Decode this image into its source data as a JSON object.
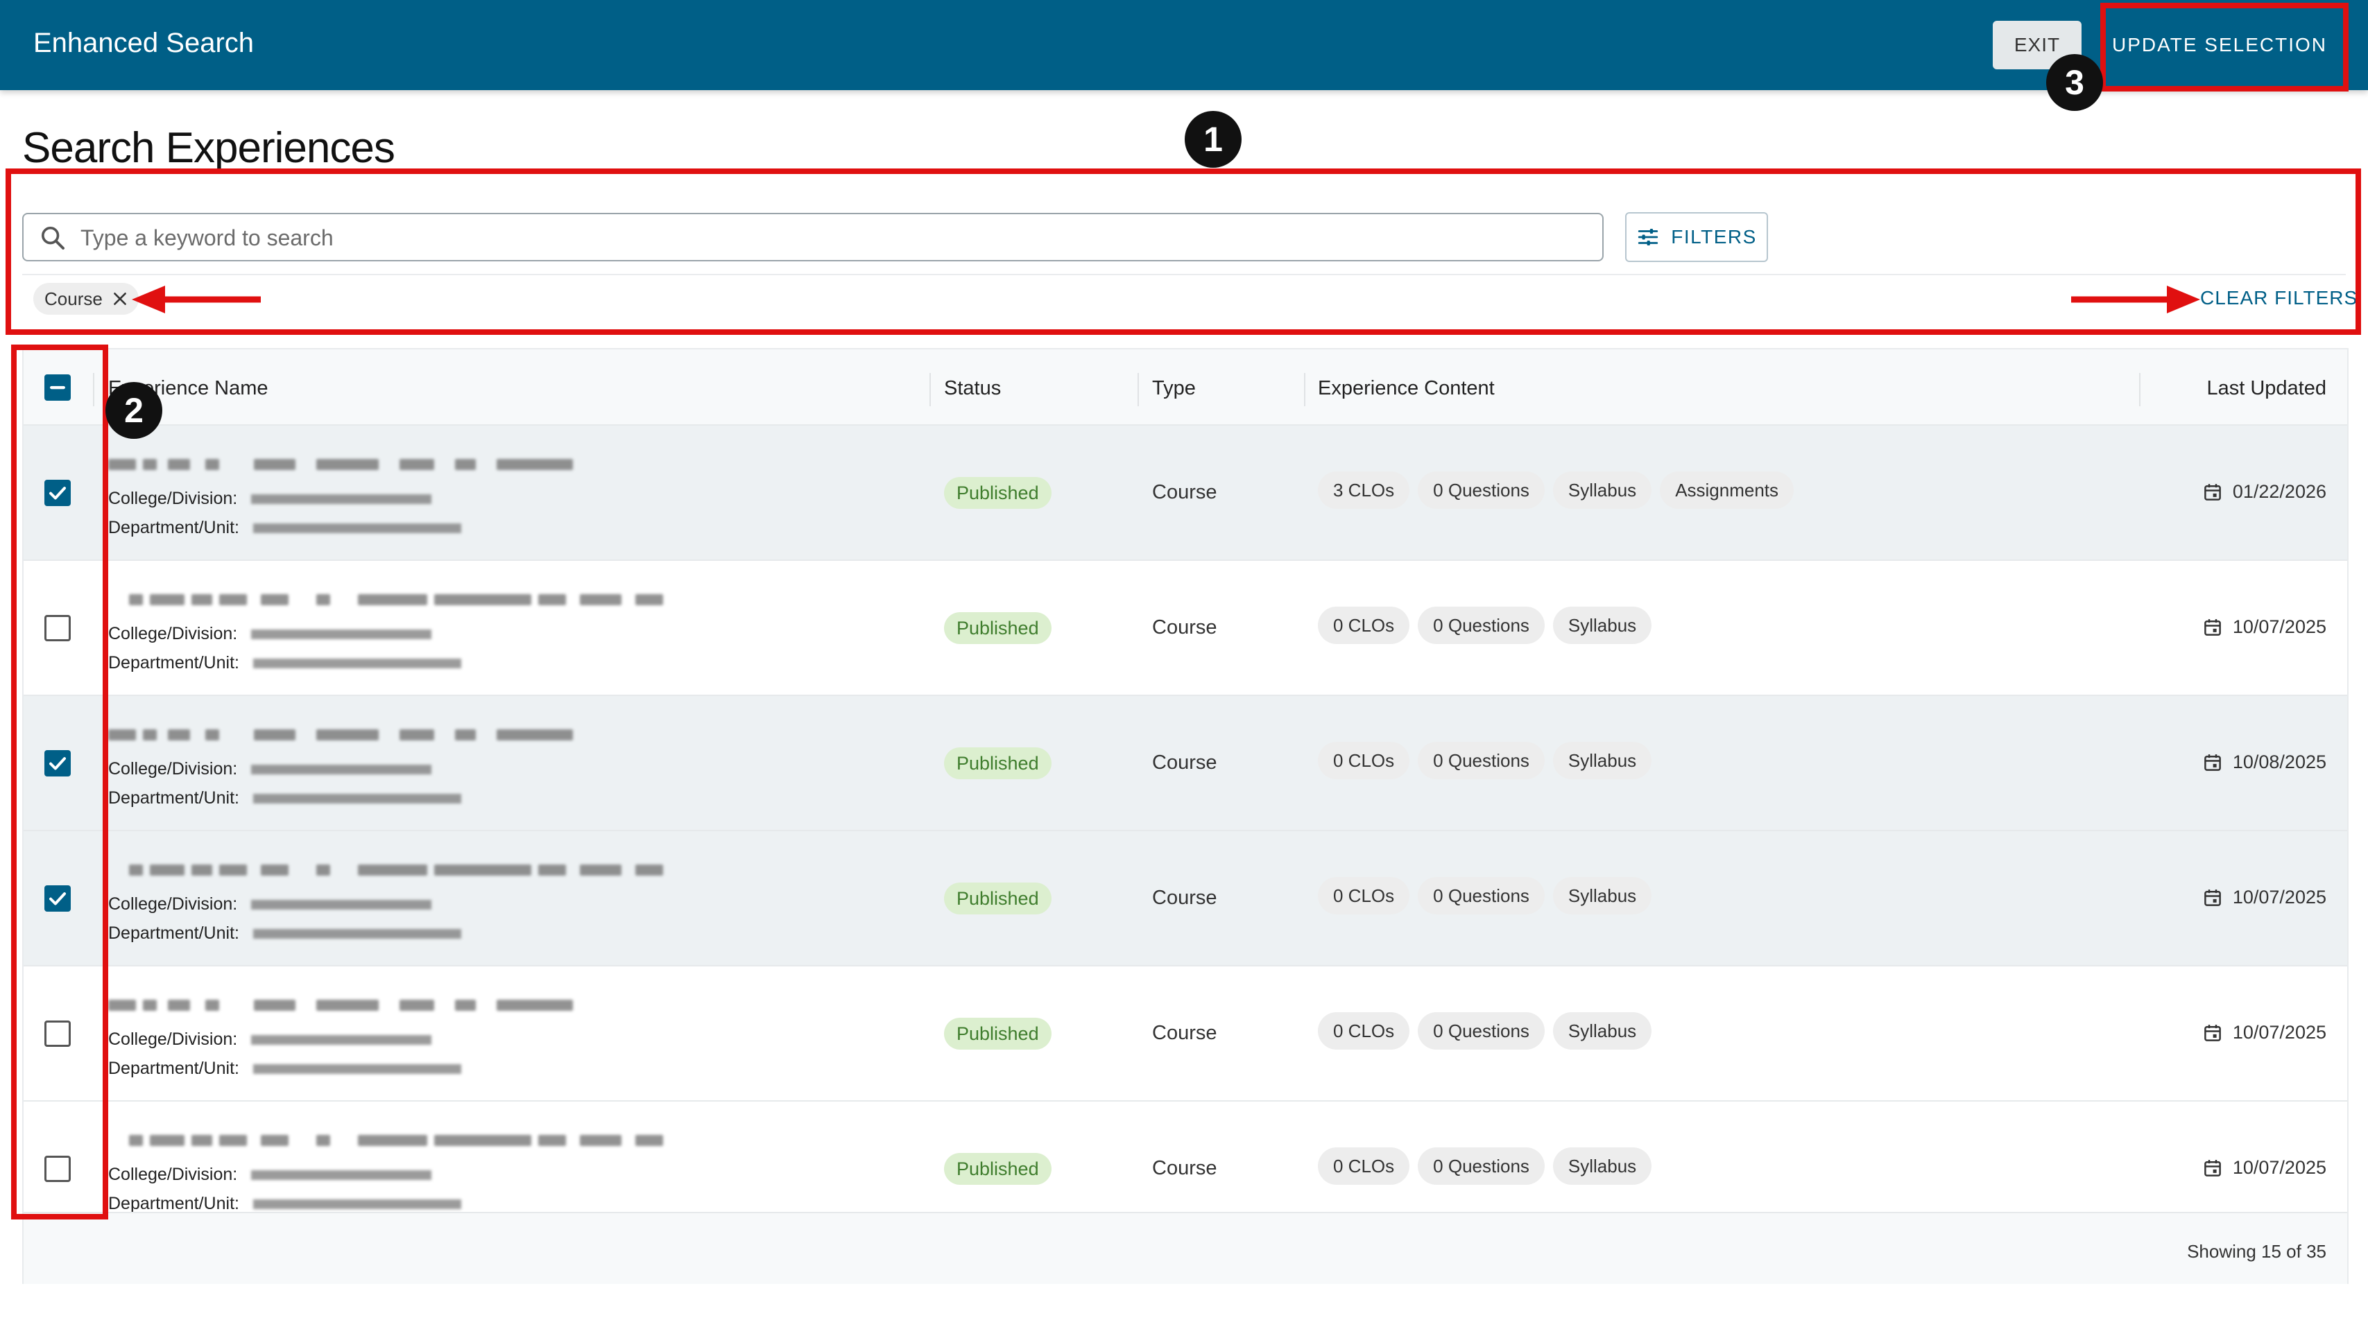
{
  "header": {
    "app_title": "Enhanced Search",
    "exit_label": "EXIT",
    "update_label": "UPDATE SELECTION"
  },
  "page": {
    "title": "Search Experiences"
  },
  "search": {
    "placeholder": "Type a keyword to search",
    "value": "",
    "filters_label": "FILTERS",
    "active_chips": [
      "Course"
    ],
    "clear_filters_label": "CLEAR FILTERS"
  },
  "table": {
    "columns": {
      "name": "Experience Name",
      "status": "Status",
      "type": "Type",
      "content": "Experience Content",
      "updated": "Last Updated"
    },
    "college_label": "College/Division:",
    "department_label": "Department/Unit:",
    "rows": [
      {
        "selected": true,
        "status": "Published",
        "type": "Course",
        "content": [
          "3 CLOs",
          "0 Questions",
          "Syllabus",
          "Assignments"
        ],
        "updated": "01/22/2026"
      },
      {
        "selected": false,
        "status": "Published",
        "type": "Course",
        "content": [
          "0 CLOs",
          "0 Questions",
          "Syllabus"
        ],
        "updated": "10/07/2025"
      },
      {
        "selected": true,
        "status": "Published",
        "type": "Course",
        "content": [
          "0 CLOs",
          "0 Questions",
          "Syllabus"
        ],
        "updated": "10/08/2025"
      },
      {
        "selected": true,
        "status": "Published",
        "type": "Course",
        "content": [
          "0 CLOs",
          "0 Questions",
          "Syllabus"
        ],
        "updated": "10/07/2025"
      },
      {
        "selected": false,
        "status": "Published",
        "type": "Course",
        "content": [
          "0 CLOs",
          "0 Questions",
          "Syllabus"
        ],
        "updated": "10/07/2025"
      },
      {
        "selected": false,
        "status": "Published",
        "type": "Course",
        "content": [
          "0 CLOs",
          "0 Questions",
          "Syllabus"
        ],
        "updated": "10/07/2025"
      }
    ],
    "footer_text": "Showing 15 of 35"
  },
  "annotations": {
    "badge_1": "1",
    "badge_2": "2",
    "badge_3": "3"
  },
  "colors": {
    "brand": "#005f87",
    "annotation": "#e01010",
    "published_bg": "#dcefcf",
    "published_text": "#3f7d2d"
  },
  "icons": {
    "search": "search-icon",
    "filters": "tune-icon",
    "chip_close": "close-icon",
    "checkbox_checked": "check-icon",
    "checkbox_indeterminate": "minus-icon",
    "calendar": "calendar-icon"
  }
}
